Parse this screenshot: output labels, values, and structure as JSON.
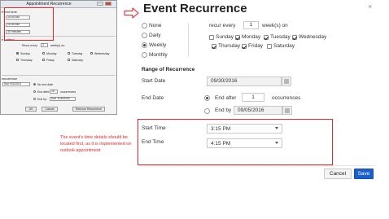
{
  "outlook": {
    "title": "Appointment Recurrence",
    "event_time_label": "Event time",
    "start_value": "10:00 AM",
    "end_value": "10:30 AM",
    "duration_value": "30 minutes",
    "pattern_label": "e pattern",
    "recur_every_label": "Recur every",
    "recur_every_value": "1",
    "weeks_on_label": "week(s) on:",
    "days": [
      "Sunday",
      "Monday",
      "Tuesday",
      "Wednesday",
      "Thursday",
      "Friday",
      "Saturday"
    ],
    "range_label": "recurrence",
    "start_date_value": "Sun 9/4/2016",
    "no_end_date_label": "No end date",
    "end_after_label": "End after:",
    "end_after_value": "10",
    "occurrences_label": "occurrences",
    "end_by_label": "End by:",
    "end_by_value": "Sun 11/6/2016",
    "ok_label": "OK",
    "cancel_label": "Cancel",
    "remove_label": "Remove Recurrence"
  },
  "dialog": {
    "title": "Event Recurrence",
    "close_glyph": "×",
    "recurrence_options": [
      "None",
      "Daily",
      "Weekly",
      "Monthly"
    ],
    "selected_recurrence": "Weekly",
    "recur_every_label": "recur every",
    "recur_every_value": "1",
    "weeks_on_label": "week(s) on",
    "days": [
      {
        "label": "Sunday",
        "checked": false
      },
      {
        "label": "Monday",
        "checked": true
      },
      {
        "label": "Tuesday",
        "checked": true
      },
      {
        "label": "Wednesday",
        "checked": true
      },
      {
        "label": "Thursday",
        "checked": true
      },
      {
        "label": "Friday",
        "checked": true
      },
      {
        "label": "Saturday",
        "checked": false
      }
    ],
    "range_heading": "Range of Recurrence",
    "start_date_label": "Start Date",
    "start_date_value": "09/30/2016",
    "end_date_label": "End Date",
    "end_after_label": "End after",
    "end_after_value": "1",
    "occurrences_label": "occurrences",
    "end_by_label": "End by",
    "end_by_value": "09/05/2016",
    "start_time_label": "Start Time",
    "start_time_value": "3:15 PM",
    "end_time_label": "End Time",
    "end_time_value": "4:15 PM",
    "cancel_label": "Cancel",
    "save_label": "Save"
  },
  "annotation": {
    "note": "The event's time details should be located first, as it is implemented on outlook appointment"
  },
  "colors": {
    "highlight_red": "#e0282a",
    "save_blue": "#1a5fcf"
  }
}
